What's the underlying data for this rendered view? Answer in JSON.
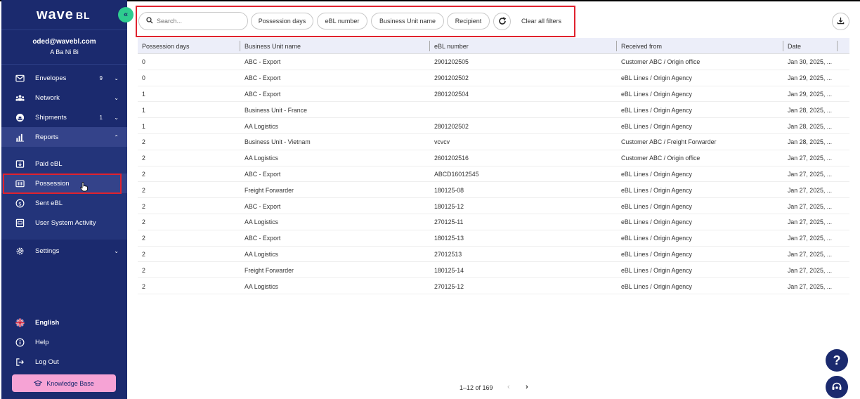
{
  "app": {
    "logo": "wave",
    "logo_suffix": "BL"
  },
  "user": {
    "email": "oded@wavebl.com",
    "name": "A Ba Ni Bi"
  },
  "sidebar": {
    "items": [
      {
        "label": "Envelopes",
        "badge": "9",
        "icon": "envelope-icon"
      },
      {
        "label": "Network",
        "badge": "",
        "icon": "network-icon"
      },
      {
        "label": "Shipments",
        "badge": "1",
        "icon": "ship-icon"
      },
      {
        "label": "Reports",
        "badge": "",
        "icon": "report-icon"
      }
    ],
    "report_subitems": [
      {
        "label": "Paid eBL",
        "icon": "paid-icon"
      },
      {
        "label": "Possession",
        "icon": "possession-icon"
      },
      {
        "label": "Sent eBL",
        "icon": "dollar-icon"
      },
      {
        "label": "User System Activity",
        "icon": "activity-icon"
      }
    ],
    "settings": "Settings",
    "bottom": [
      {
        "label": "English",
        "icon": "uk-flag-icon"
      },
      {
        "label": "Help",
        "icon": "info-icon"
      },
      {
        "label": "Log Out",
        "icon": "logout-icon"
      }
    ],
    "knowledge_base": "Knowledge Base"
  },
  "toolbar": {
    "search_placeholder": "Search...",
    "filters": [
      "Possession days",
      "eBL number",
      "Business Unit name",
      "Recipient"
    ],
    "clear_all": "Clear all filters"
  },
  "table": {
    "columns": [
      "Possession days",
      "Business Unit name",
      "eBL number",
      "Received from",
      "Date"
    ],
    "rows": [
      [
        "0",
        "ABC - Export",
        "2901202505",
        "Customer ABC / Origin office",
        "Jan 30, 2025, ..."
      ],
      [
        "0",
        "ABC - Export",
        "2901202502",
        "eBL Lines / Origin Agency",
        "Jan 29, 2025, ..."
      ],
      [
        "1",
        "ABC - Export",
        "2801202504",
        "eBL Lines / Origin Agency",
        "Jan 29, 2025, ..."
      ],
      [
        "1",
        "Business Unit - France",
        "",
        "eBL Lines / Origin Agency",
        "Jan 28, 2025, ..."
      ],
      [
        "1",
        "AA Logistics",
        "2801202502",
        "eBL Lines / Origin Agency",
        "Jan 28, 2025, ..."
      ],
      [
        "2",
        "Business Unit - Vietnam",
        "vcvcv",
        "Customer ABC / Freight Forwarder",
        "Jan 28, 2025, ..."
      ],
      [
        "2",
        "AA Logistics",
        "2601202516",
        "Customer ABC / Origin office",
        "Jan 27, 2025, ..."
      ],
      [
        "2",
        "ABC - Export",
        "ABCD16012545",
        "eBL Lines / Origin Agency",
        "Jan 27, 2025, ..."
      ],
      [
        "2",
        "Freight Forwarder",
        "180125-08",
        "eBL Lines / Origin Agency",
        "Jan 27, 2025, ..."
      ],
      [
        "2",
        "ABC - Export",
        "180125-12",
        "eBL Lines / Origin Agency",
        "Jan 27, 2025, ..."
      ],
      [
        "2",
        "AA Logistics",
        "270125-11",
        "eBL Lines / Origin Agency",
        "Jan 27, 2025, ..."
      ],
      [
        "2",
        "ABC - Export",
        "180125-13",
        "eBL Lines / Origin Agency",
        "Jan 27, 2025, ..."
      ],
      [
        "2",
        "AA Logistics",
        "27012513",
        "eBL Lines / Origin Agency",
        "Jan 27, 2025, ..."
      ],
      [
        "2",
        "Freight Forwarder",
        "180125-14",
        "eBL Lines / Origin Agency",
        "Jan 27, 2025, ..."
      ],
      [
        "2",
        "AA Logistics",
        "270125-12",
        "eBL Lines / Origin Agency",
        "Jan 27, 2025, ..."
      ]
    ]
  },
  "pagination": {
    "label": "1–12 of 169"
  },
  "colors": {
    "sidebar": "#1b2a6e",
    "accent": "#2ecc8f",
    "highlight": "#e0222e",
    "kb_button": "#f6a3d5"
  }
}
